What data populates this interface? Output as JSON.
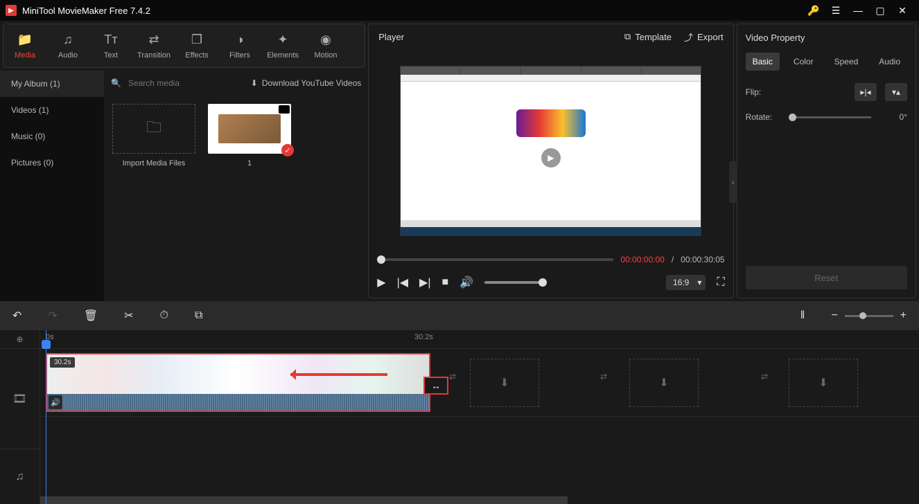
{
  "titlebar": {
    "title": "MiniTool MovieMaker Free 7.4.2"
  },
  "toolbar": {
    "items": [
      {
        "label": "Media",
        "icon": "📁"
      },
      {
        "label": "Audio",
        "icon": "♫"
      },
      {
        "label": "Text",
        "icon": "Tᴛ"
      },
      {
        "label": "Transition",
        "icon": "⇄"
      },
      {
        "label": "Effects",
        "icon": "❐"
      },
      {
        "label": "Filters",
        "icon": "◑"
      },
      {
        "label": "Elements",
        "icon": "✦"
      },
      {
        "label": "Motion",
        "icon": "◉"
      }
    ]
  },
  "album": {
    "items": [
      {
        "label": "My Album (1)"
      },
      {
        "label": "Videos (1)"
      },
      {
        "label": "Music (0)"
      },
      {
        "label": "Pictures (0)"
      }
    ]
  },
  "mediaSearch": {
    "placeholder": "Search media"
  },
  "downloadYT": "Download YouTube Videos",
  "importLabel": "Import Media Files",
  "mediaClip": {
    "name": "1"
  },
  "player": {
    "title": "Player",
    "template": "Template",
    "export": "Export",
    "currentTime": "00:00:00:00",
    "sep": " / ",
    "totalTime": "00:00:30:05",
    "ratio": "16:9"
  },
  "props": {
    "title": "Video Property",
    "tabs": [
      "Basic",
      "Color",
      "Speed",
      "Audio"
    ],
    "flipLabel": "Flip:",
    "rotateLabel": "Rotate:",
    "rotateVal": "0°",
    "reset": "Reset"
  },
  "timeline": {
    "ruler": {
      "start": "0s",
      "mid": "30.2s"
    },
    "clipDuration": "30.2s"
  }
}
